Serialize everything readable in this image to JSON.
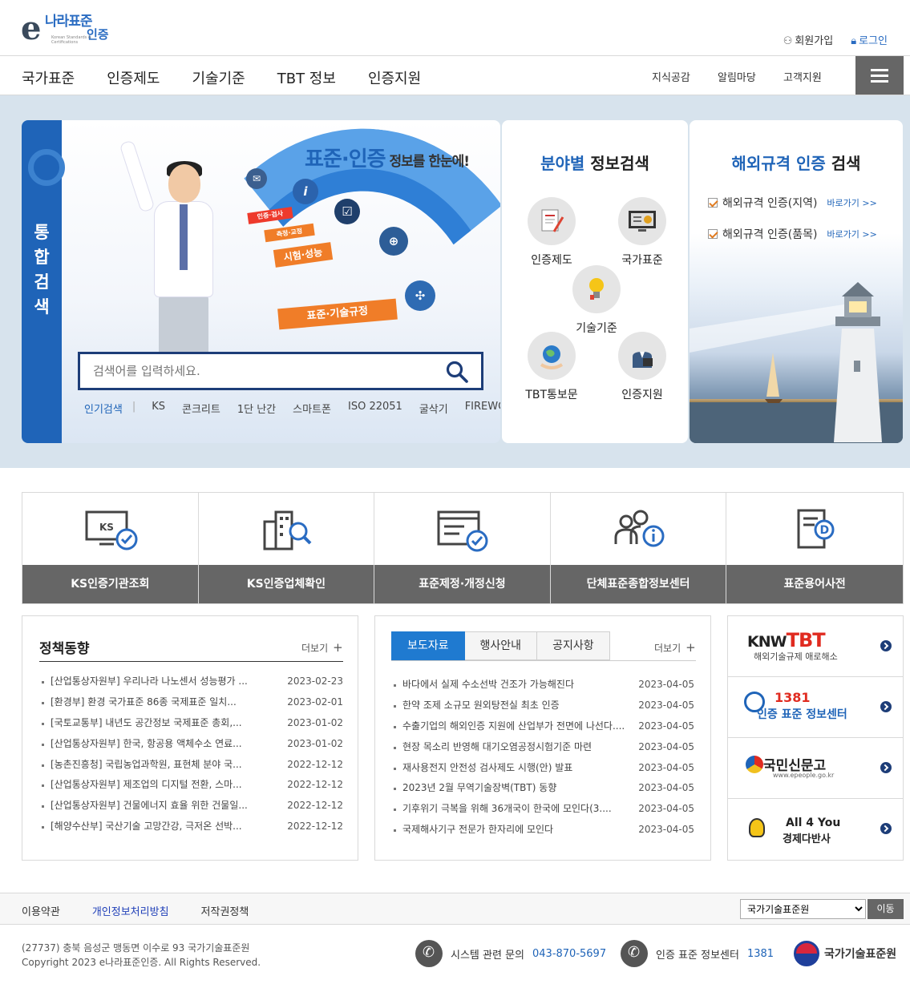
{
  "logo": {
    "main": "나라표준",
    "sub": "인증",
    "tagline": "Korean Standards & Certifications"
  },
  "util": {
    "join": "회원가입",
    "login": "로그인"
  },
  "gnb": {
    "main": [
      "국가표준",
      "인증제도",
      "기술기준",
      "TBT 정보",
      "인증지원"
    ],
    "side": [
      "지식공감",
      "알림마당",
      "고객지원"
    ]
  },
  "hero": {
    "tab_label": "통\n합\n검\n색",
    "title_em": "표준·인증",
    "title_rest": " 정보를 한눈에!",
    "signs": [
      "인증·검사",
      "측정·교정",
      "시험·성능",
      "표준·기술규정"
    ],
    "search_placeholder": "검색어를 입력하세요.",
    "popular_label": "인기검색",
    "popular": [
      "KS",
      "콘크리트",
      "1단 난간",
      "스마트폰",
      "ISO 22051",
      "굴삭기",
      "FIREWORKS"
    ]
  },
  "field": {
    "title_em": "분야별",
    "title_rest": " 정보검색",
    "items": [
      "인증제도",
      "국가표준",
      "기술기준",
      "TBT통보문",
      "인증지원"
    ]
  },
  "foreign": {
    "title_em": "해외규격 인증",
    "title_rest": " 검색",
    "rows": [
      {
        "label": "해외규격 인증(지역)",
        "link": "바로가기 >>"
      },
      {
        "label": "해외규격 인증(품목)",
        "link": "바로가기 >>"
      }
    ]
  },
  "quick": [
    "KS인증기관조회",
    "KS인증업체확인",
    "표준제정·개정신청",
    "단체표준종합정보센터",
    "표준용어사전"
  ],
  "policy": {
    "title": "정책동향",
    "more": "더보기",
    "items": [
      {
        "t": "[산업통상자원부] 우리나라 나노센서 성능평가 ...",
        "d": "2023-02-23"
      },
      {
        "t": "[환경부] 환경 국가표준 86종 국제표준 일치...",
        "d": "2023-02-01"
      },
      {
        "t": "[국토교통부] 내년도 공간정보 국제표준 총회,...",
        "d": "2023-01-02"
      },
      {
        "t": "[산업통상자원부] 한국, 항공용 액체수소 연료...",
        "d": "2023-01-02"
      },
      {
        "t": "[농촌진흥청] 국립농업과학원, 표현체 분야 국...",
        "d": "2022-12-12"
      },
      {
        "t": "[산업통상자원부] 제조업의 디지털 전환, 스마...",
        "d": "2022-12-12"
      },
      {
        "t": "[산업통상자원부] 건물에너지 효율 위한 건물일...",
        "d": "2022-12-12"
      },
      {
        "t": "[해양수산부] 국산기술 고망간강, 극저온 선박...",
        "d": "2022-12-12"
      }
    ]
  },
  "press": {
    "tabs": [
      "보도자료",
      "행사안내",
      "공지사항"
    ],
    "more": "더보기",
    "items": [
      {
        "t": "바다에서 실제 수소선박 건조가 가능해진다",
        "d": "2023-04-05"
      },
      {
        "t": "한약 조제 소규모 원외탕전실 최초 인증",
        "d": "2023-04-05"
      },
      {
        "t": "수출기업의 해외인증 지원에 산업부가 전면에 나선다....",
        "d": "2023-04-05"
      },
      {
        "t": "현장 목소리 반영해 대기오염공정시험기준 마련",
        "d": "2023-04-05"
      },
      {
        "t": "재사용전지 안전성 검사제도 시행(안) 발표",
        "d": "2023-04-05"
      },
      {
        "t": "2023년 2월 무역기술장벽(TBT) 동향",
        "d": "2023-04-05"
      },
      {
        "t": "기후위기 극복을 위해 36개국이 한국에 모인다(3....",
        "d": "2023-04-05"
      },
      {
        "t": "국제해사기구 전문가 한자리에 모인다",
        "d": "2023-04-05"
      }
    ]
  },
  "banners": {
    "knowtbt_a": "KN",
    "knowtbt_b": "W",
    "knowtbt_c": "TBT",
    "knowtbt_sub": "해외기술규제 애로해소",
    "c1381_num": "1381",
    "c1381_label": "인증 표준 정보센터",
    "epeople": "국민신문고",
    "epeople_url": "www.epeople.go.kr",
    "allyou_1": "All 4 You",
    "allyou_2": "경제다반사"
  },
  "footer": {
    "links": [
      "이용약관",
      "개인정보처리방침",
      "저작권정책"
    ],
    "select_value": "국가기술표준원",
    "go": "이동",
    "address": "(27737) 충북 음성군 맹동면 이수로 93 국가기술표준원",
    "copyright": "Copyright 2023 e나라표준인증. All Rights Reserved.",
    "contact1_label": "시스템 관련 문의",
    "contact1_num": "043-870-5697",
    "contact2_label": "인증 표준 정보센터",
    "contact2_num": "1381",
    "org": "국가기술표준원"
  }
}
